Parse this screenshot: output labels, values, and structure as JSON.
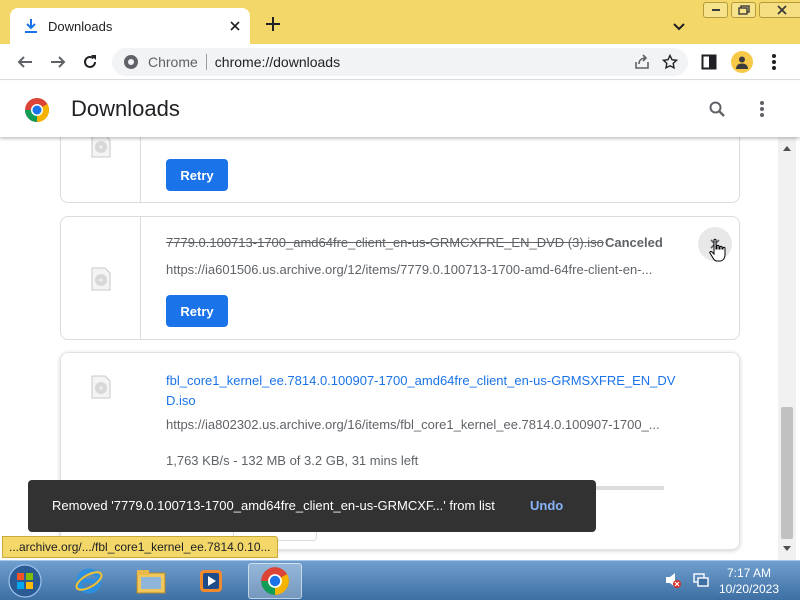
{
  "tab": {
    "title": "Downloads",
    "icon": "download-arrow-icon"
  },
  "omnibox": {
    "chip": "Chrome",
    "url": "chrome://downloads"
  },
  "page": {
    "title": "Downloads"
  },
  "downloads": {
    "retry_label": "Retry",
    "item2": {
      "filename": "7779.0.100713-1700_amd64fre_client_en-us-GRMCXFRE_EN_DVD (3).iso",
      "status": "Canceled",
      "url": "https://ia601506.us.archive.org/12/items/7779.0.100713-1700-amd-64fre-client-en-..."
    },
    "item3": {
      "filename_line1": "fbl_core1_kernel_ee.7814.0.100907-1700_amd64fre_client_en-us-GRMSXFRE_EN_DV",
      "filename_line2": "D.iso",
      "url": "https://ia802302.us.archive.org/16/items/fbl_core1_kernel_ee.7814.0.100907-1700_...",
      "progress_text": "1,763 KB/s - 132 MB of 3.2 GB, 31 mins left",
      "progress_fraction": 0.04
    }
  },
  "toast": {
    "message": "Removed '7779.0.100713-1700_amd64fre_client_en-us-GRMCXF...' from list",
    "undo": "Undo"
  },
  "status_bubble": "...archive.org/.../fbl_core1_kernel_ee.7814.0.10...",
  "taskbar": {
    "time": "7:17 AM",
    "date": "10/20/2023",
    "apps": [
      "internet-explorer-icon",
      "file-explorer-icon",
      "media-player-icon",
      "chrome-icon"
    ]
  },
  "colors": {
    "accent": "#1a73e8",
    "frame": "#f3d769",
    "toast_bg": "#323232",
    "toast_link": "#8ab4f8"
  }
}
